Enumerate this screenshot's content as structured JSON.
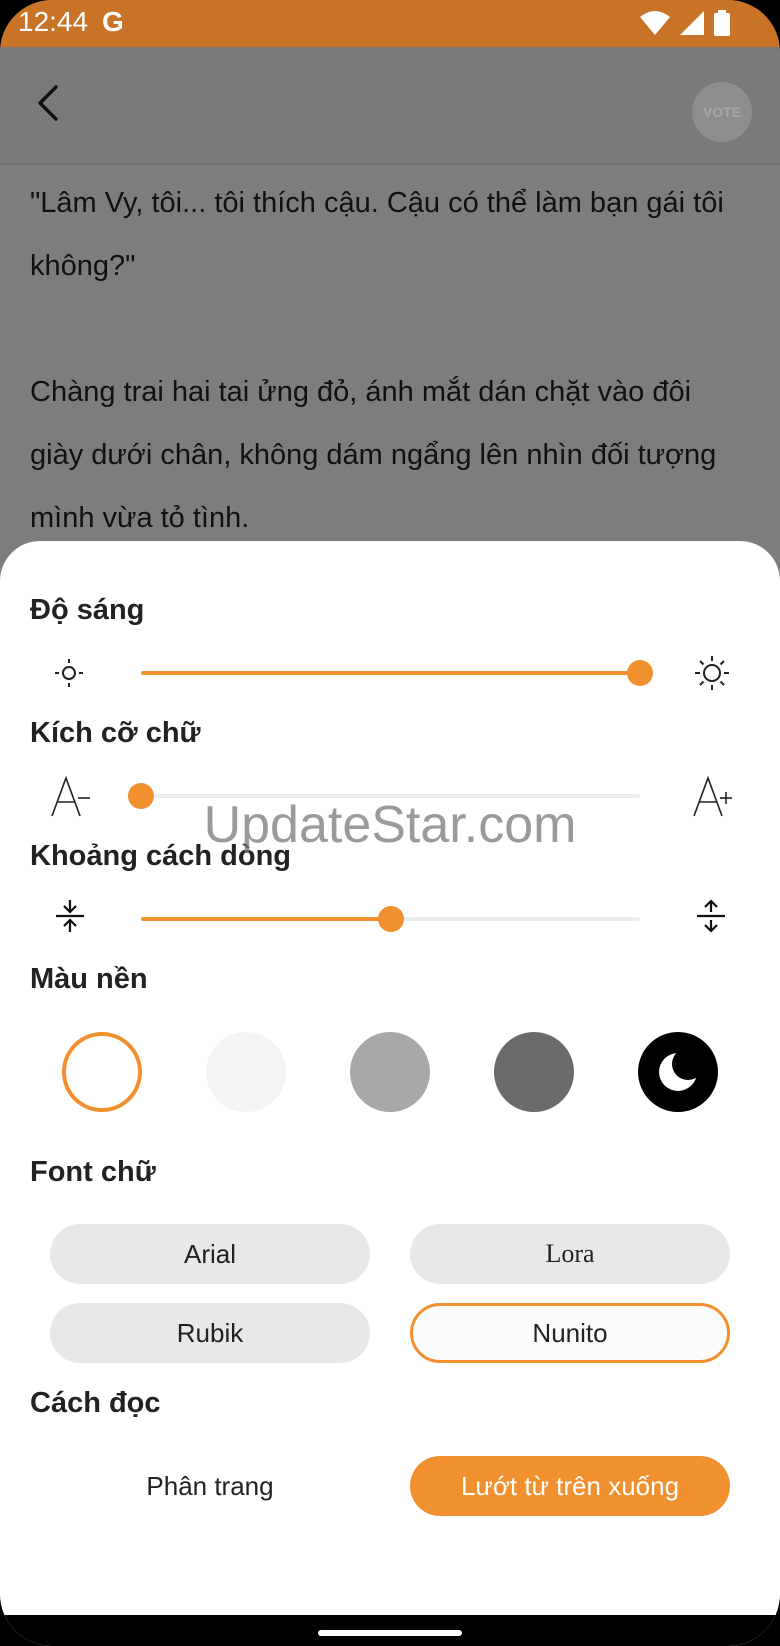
{
  "status_bar": {
    "time": "12:44",
    "google_glyph": "G",
    "icons": [
      "wifi-icon",
      "signal-icon",
      "battery-icon"
    ]
  },
  "toolbar": {
    "back_icon": "chevron-left-icon",
    "vote_label": "VOTE"
  },
  "reading": {
    "paragraphs": [
      "\"Lâm Vy, tôi... tôi thích cậu. Cậu có thể làm bạn gái tôi không?\"",
      "Chàng trai hai tai ửng đỏ, ánh mắt dán chặt vào đôi giày dưới chân, không dám ngẩng lên nhìn đối tượng mình vừa tỏ tình."
    ]
  },
  "settings": {
    "brightness": {
      "label": "Độ sáng",
      "value": 1.0
    },
    "font_size": {
      "label": "Kích cỡ chữ",
      "value": 0.0
    },
    "line_spacing": {
      "label": "Khoảng cách dòng",
      "value": 0.5
    },
    "background": {
      "label": "Màu nền",
      "swatches": [
        {
          "name": "white",
          "color": "#ffffff",
          "selected": true
        },
        {
          "name": "light-gray",
          "color": "#f4f4f4",
          "selected": false
        },
        {
          "name": "gray",
          "color": "#a8a8a8",
          "selected": false
        },
        {
          "name": "dark-gray",
          "color": "#6b6b6b",
          "selected": false
        },
        {
          "name": "black-night",
          "color": "#000000",
          "selected": false
        }
      ]
    },
    "font": {
      "label": "Font chữ",
      "options": [
        "Arial",
        "Lora",
        "Rubik",
        "Nunito"
      ],
      "selected": "Nunito"
    },
    "reading_mode": {
      "label": "Cách đọc",
      "options": [
        "Phân trang",
        "Lướt từ trên xuống"
      ],
      "selected": "Lướt từ trên xuống"
    }
  },
  "watermark": "UpdateStar.com",
  "colors": {
    "accent": "#f0902f",
    "status_bar": "#c87326",
    "overlay": "#7d7d7d"
  }
}
